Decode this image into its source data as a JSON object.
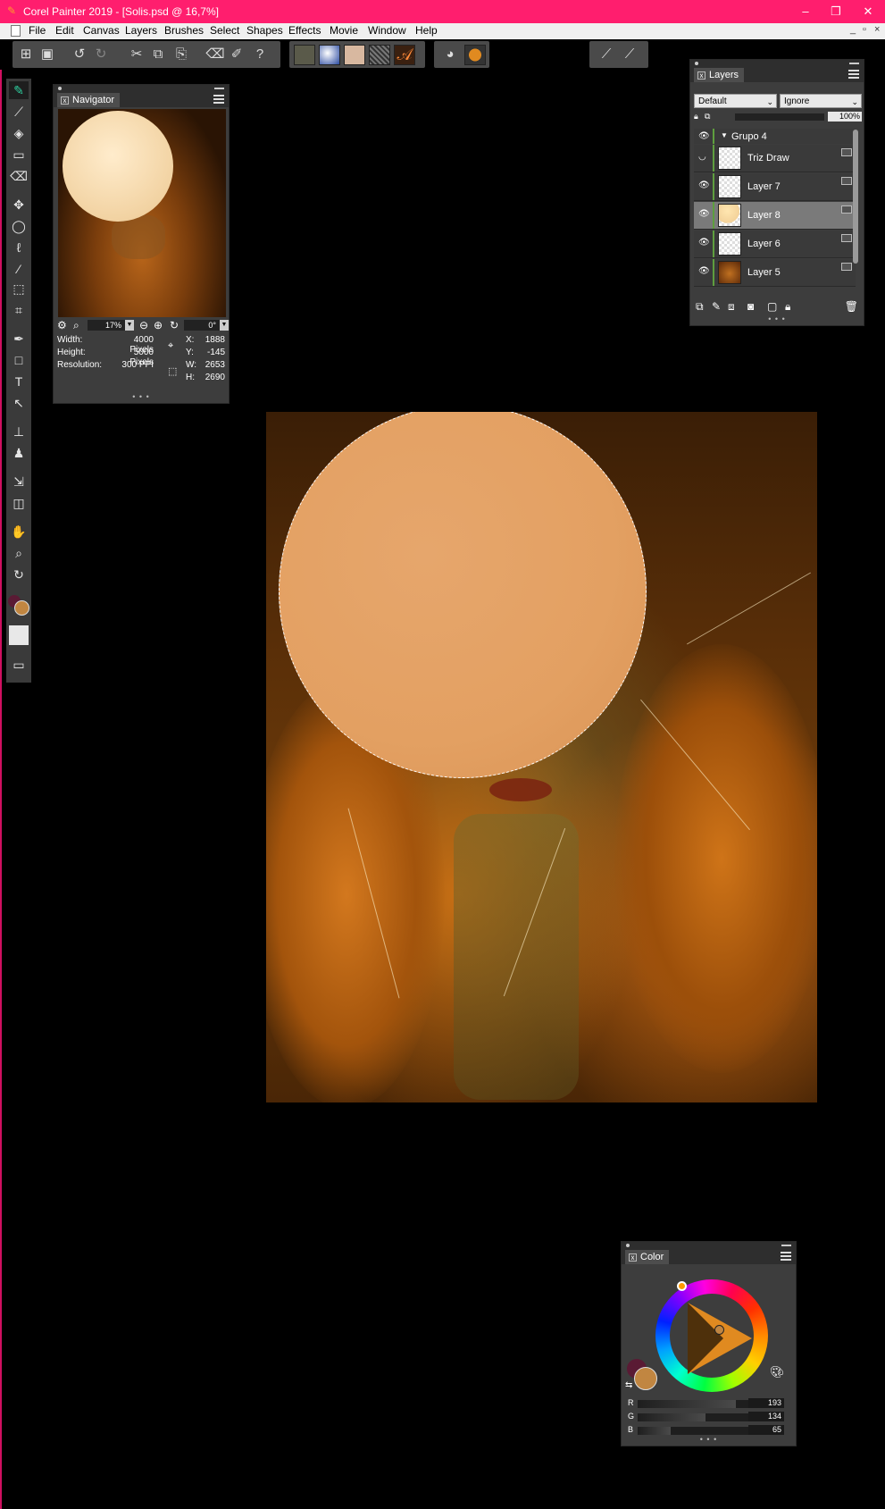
{
  "window": {
    "title": "Corel Painter 2019 - [Solis.psd @ 16,7%]",
    "min": "–",
    "restore": "❐",
    "close": "✕"
  },
  "menu": {
    "items": [
      "File",
      "Edit",
      "Canvas",
      "Layers",
      "Brushes",
      "Select",
      "Shapes",
      "Effects",
      "Movie",
      "Window",
      "Help"
    ],
    "doc_min": "_",
    "doc_restore": "▫",
    "doc_close": "×"
  },
  "toolbar": {
    "icons": [
      "new-document-icon",
      "save-icon",
      "undo-icon",
      "redo-icon",
      "cut-icon",
      "copy-icon",
      "paste-icon",
      "eraser-layer-icon",
      "brush-icon",
      "help-icon"
    ],
    "paper_icons": [
      "paper-texture-icon",
      "flow-map-icon",
      "paper-grain-icon",
      "pattern-icon",
      "brush-stroke-icon"
    ],
    "color_icons": [
      "brush-ghost-icon",
      "color-set-icon"
    ],
    "brush_icons": [
      "brush-select-icon",
      "brush-variant-icon"
    ]
  },
  "navigator": {
    "tab": "Navigator",
    "zoom": "17%",
    "angle": "0°",
    "width_label": "Width:",
    "width_value": "4000 Pixels",
    "height_label": "Height:",
    "height_value": "5000 Pixels",
    "resolution_label": "Resolution:",
    "resolution_value": "300 PPI",
    "x_label": "X:",
    "x_value": "1888",
    "y_label": "Y:",
    "y_value": "-145",
    "w_label": "W:",
    "w_value": "2653",
    "h_label": "H:",
    "h_value": "2690",
    "more": "• • •"
  },
  "layers": {
    "tab": "Layers",
    "composite_method": "Default",
    "preserve": "Ignore",
    "opacity": "100%",
    "group": "Grupo 4",
    "items": [
      {
        "name": "Triz Draw",
        "visible": "hidden"
      },
      {
        "name": "Layer 7",
        "visible": "visible"
      },
      {
        "name": "Layer 8",
        "visible": "visible"
      },
      {
        "name": "Layer 6",
        "visible": "visible"
      },
      {
        "name": "Layer 5",
        "visible": "visible"
      }
    ],
    "more": "• • •"
  },
  "color": {
    "tab": "Color",
    "r_label": "R",
    "g_label": "G",
    "b_label": "B",
    "r": "193",
    "g": "134",
    "b": "65",
    "r_fraction": 0.757,
    "g_fraction": 0.525,
    "b_fraction": 0.255,
    "main_color": "#c18641",
    "secondary_color": "#5a1a34",
    "more": "• • •"
  }
}
